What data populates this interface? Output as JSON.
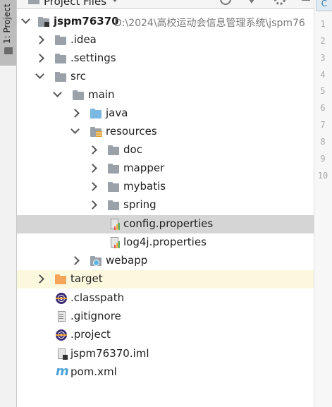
{
  "sidebar": {
    "tab_label": "1: Project"
  },
  "header": {
    "title": "Project Files"
  },
  "gutter": {
    "tab_glyph": "C",
    "line_numbers": [
      "1",
      "2",
      "3",
      "4",
      "5",
      "6",
      "7",
      "8",
      "9",
      "10"
    ]
  },
  "tree": {
    "root": {
      "label": "jspm76370",
      "path": "D:\\2024\\高校运动会信息管理系统\\jspm76"
    },
    "items": [
      {
        "label": ".idea"
      },
      {
        "label": ".settings"
      },
      {
        "label": "src"
      },
      {
        "label": "main"
      },
      {
        "label": "java"
      },
      {
        "label": "resources"
      },
      {
        "label": "doc"
      },
      {
        "label": "mapper"
      },
      {
        "label": "mybatis"
      },
      {
        "label": "spring"
      },
      {
        "label": "config.properties"
      },
      {
        "label": "log4j.properties"
      },
      {
        "label": "webapp"
      },
      {
        "label": "target"
      },
      {
        "label": ".classpath"
      },
      {
        "label": ".gitignore"
      },
      {
        "label": ".project"
      },
      {
        "label": "jspm76370.iml"
      },
      {
        "label": "pom.xml"
      }
    ]
  },
  "icons": [
    "project-folder-icon",
    "folder-icon",
    "source-folder-icon",
    "resources-folder-icon",
    "web-folder-icon",
    "excluded-folder-icon",
    "properties-file-icon",
    "eclipse-file-icon",
    "text-file-icon",
    "module-file-icon",
    "maven-icon"
  ]
}
